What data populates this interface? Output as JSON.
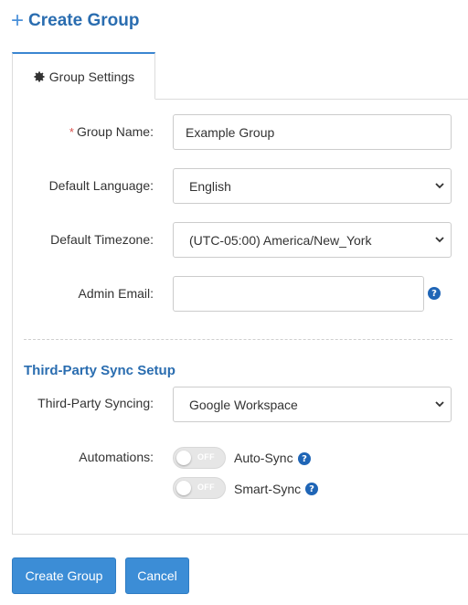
{
  "header": {
    "title": "Create Group",
    "icon": "plus-icon"
  },
  "tabs": [
    {
      "label": "Group Settings",
      "icon": "gear-icon",
      "active": true
    }
  ],
  "form": {
    "group_name": {
      "label": "Group Name:",
      "required_mark": "*",
      "value": "Example Group"
    },
    "default_language": {
      "label": "Default Language:",
      "value": "English"
    },
    "default_timezone": {
      "label": "Default Timezone:",
      "value": "(UTC-05:00) America/New_York"
    },
    "admin_email": {
      "label": "Admin Email:",
      "value": "",
      "help_icon": "question-icon"
    }
  },
  "sync": {
    "section_title": "Third-Party Sync Setup",
    "syncing": {
      "label": "Third-Party Syncing:",
      "value": "Google Workspace"
    },
    "automations": {
      "label": "Automations:",
      "items": [
        {
          "label": "Auto-Sync",
          "state": "OFF"
        },
        {
          "label": "Smart-Sync",
          "state": "OFF"
        }
      ]
    }
  },
  "actions": {
    "create_label": "Create Group",
    "cancel_label": "Cancel"
  },
  "colors": {
    "accent": "#3c8dd6",
    "title": "#2a6db0",
    "required": "#d9534f",
    "help": "#1f65b6"
  }
}
